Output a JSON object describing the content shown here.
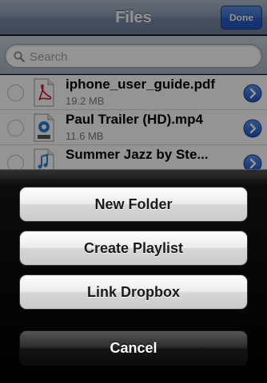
{
  "navbar": {
    "title": "Files",
    "done_label": "Done"
  },
  "search": {
    "placeholder": "Search"
  },
  "files": [
    {
      "name": "iphone_user_guide.pdf",
      "size": "19.2 MB",
      "icon": "pdf-file-icon"
    },
    {
      "name": "Paul Trailer (HD).mp4",
      "size": "11.6 MB",
      "icon": "movie-file-icon"
    },
    {
      "name": "Summer Jazz by Ste...",
      "size": "",
      "icon": "audio-file-icon"
    }
  ],
  "action_sheet": {
    "new_folder": "New Folder",
    "create_playlist": "Create Playlist",
    "link_dropbox": "Link Dropbox",
    "cancel": "Cancel"
  },
  "colors": {
    "accent_done": "#2a5fcb",
    "disclosure": "#2a68d6"
  }
}
